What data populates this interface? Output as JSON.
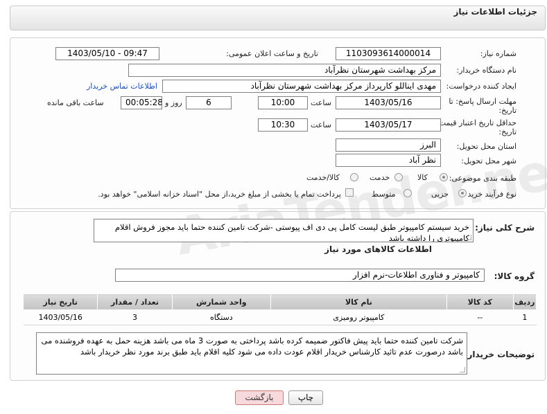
{
  "header": {
    "title": "جزئیات اطلاعات نیاز"
  },
  "form": {
    "need_number": {
      "label": "شماره نیاز:",
      "value": "1103093614000014"
    },
    "announce": {
      "label": "تاریخ و ساعت اعلان عمومی:",
      "value": "1403/05/10 - 09:47"
    },
    "buyer": {
      "label": "نام دستگاه خریدار:",
      "value": "مرکز بهداشت شهرستان نظرآباد"
    },
    "creator": {
      "label": "ایجاد کننده درخواست:",
      "value": "مهدی ایناللو کارپرداز مرکز بهداشت شهرستان نظرآباد",
      "contact_link": "اطلاعات تماس خریدار"
    },
    "deadline": {
      "label_line1": "مهلت ارسال پاسخ: تا",
      "label_line2": "تاریخ:",
      "date": "1403/05/16",
      "time_label": "ساعت",
      "time": "10:00",
      "days": "6",
      "days_label": "روز و",
      "remaining": "00:05:28",
      "remaining_label": "ساعت باقی مانده"
    },
    "validity": {
      "label_line1": "حداقل تاریخ اعتبار قیمت: تا",
      "label_line2": "تاریخ:",
      "date": "1403/05/17",
      "time_label": "ساعت",
      "time": "10:30"
    },
    "province": {
      "label": "استان محل تحویل:",
      "value": "البرز"
    },
    "city": {
      "label": "شهر محل تحویل:",
      "value": "نظر آباد"
    },
    "category": {
      "label": "طبقه بندی موضوعی:",
      "options": [
        "کالا",
        "خدمت",
        "کالا/خدمت"
      ],
      "selected": "کالا"
    },
    "process": {
      "label": "نوع فرآیند خرید :",
      "options": [
        "جزیی",
        "متوسط"
      ],
      "selected": "جزیی",
      "checkbox_text": "پرداخت تمام یا بخشی از مبلغ خرید،از محل \"اسناد خزانه اسلامی\" خواهد بود."
    }
  },
  "description": {
    "label": "شرح کلی نیاز:",
    "text": "خرید سیستم کامپیوتر طبق لیست کامل پی دی اف پیوستی -شرکت تامین کننده حتما باید مجوز فروش اقلام کامپیوتری را داشته باشد"
  },
  "goods": {
    "section_title": "اطلاعات کالاهای مورد نیاز",
    "group_label": "گروه کالا:",
    "group_value": "کامپیوتر و فناوری اطلاعات-نرم افزار",
    "columns": [
      "ردیف",
      "کد کالا",
      "نام کالا",
      "واحد شمارش",
      "تعداد / مقدار",
      "تاریخ نیاز"
    ],
    "rows": [
      {
        "row": "1",
        "code": "--",
        "name": "کامپیوتر رومیزی",
        "unit": "دستگاه",
        "qty": "3",
        "date": "1403/05/16"
      }
    ]
  },
  "buyer_notes": {
    "label": "توضیحات خریدار:",
    "text": "شرکت تامین کننده حتما باید پیش فاکتور ضمیمه کرده باشد پرداختی به صورت 3 ماه می باشد هزینه حمل به عهده فروشنده می باشد درصورت عدم تائید کارشناس خریدار اقلام عودت داده می شود کلیه اقلام باید طبق برند مورد نظر خریدار باشد"
  },
  "buttons": {
    "print": "چاپ",
    "back": "بازگشت"
  },
  "watermark": "AriaTender.net"
}
